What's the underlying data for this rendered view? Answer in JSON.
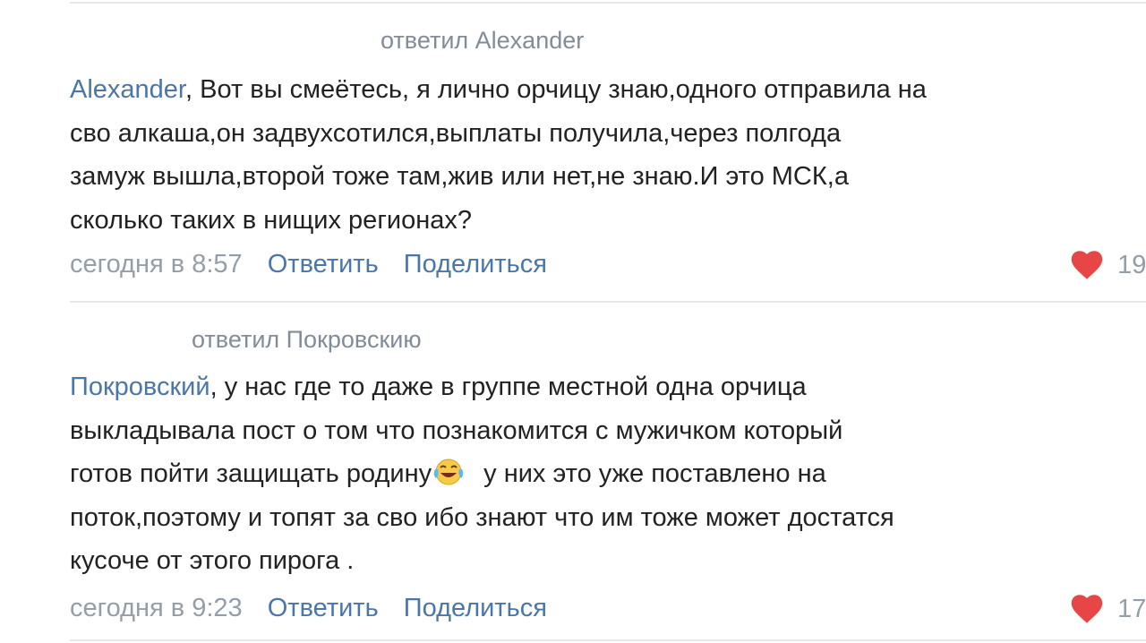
{
  "comments": [
    {
      "reply_to": "ответил Alexander",
      "mention": "Alexander",
      "lines": [
        ", Вот вы смеётесь, я лично орчицу знаю,одного отправила на",
        "сво алкаша,он задвухсотился,выплаты получила,через полгода",
        "замуж вышла,второй тоже там,жив или нет,не знаю.И это МСК,а",
        "сколько таких в нищих регионах?"
      ],
      "time": "сегодня в 8:57",
      "reply_label": "Ответить",
      "share_label": "Поделиться",
      "likes": "19"
    },
    {
      "reply_to": "ответил Покровскию",
      "mention": "Покровский",
      "lines": [
        ", у нас где то даже в группе местной одна орчица",
        "выкладывала пост о том что познакомится с мужичком который",
        "готов пойти защищать родину",
        " у них это уже поставлено на",
        "поток,поэтому и топят за сво ибо знают что им тоже может достатся",
        "кусоче от этого пирога ."
      ],
      "emoji": "face-with-tears-of-joy-emoji",
      "time": "сегодня в 9:23",
      "reply_label": "Ответить",
      "share_label": "Поделиться",
      "likes": "17"
    }
  ],
  "colors": {
    "link": "#4a76a8",
    "meta": "#818c99",
    "text": "#222222",
    "like": "#e64646",
    "divider": "#e7e8ec"
  }
}
